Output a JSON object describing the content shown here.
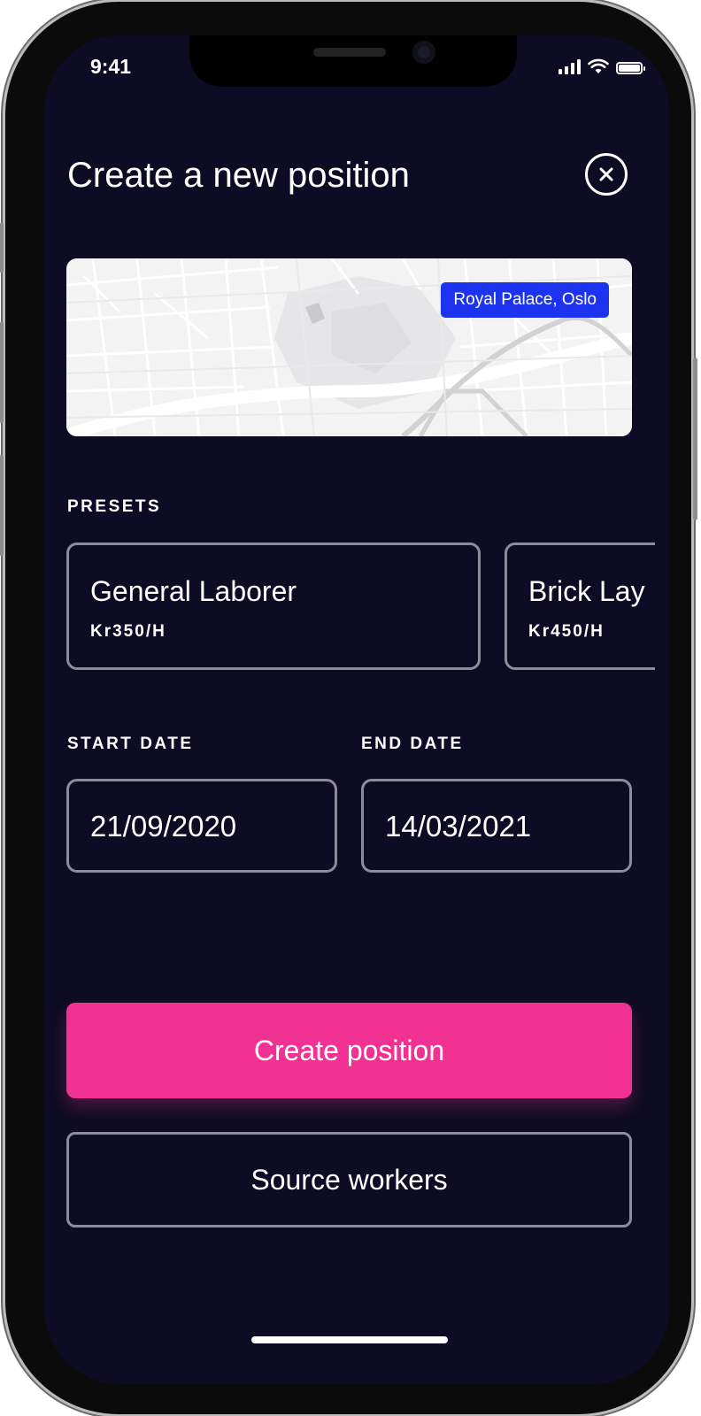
{
  "status_bar": {
    "time": "9:41"
  },
  "header": {
    "title": "Create a new position",
    "close_icon": "close-circle-icon"
  },
  "map": {
    "location_label": "Royal Palace, Oslo"
  },
  "presets": {
    "label": "PRESETS",
    "items": [
      {
        "name": "General Laborer",
        "rate": "Kr350/H"
      },
      {
        "name": "Brick Lay",
        "rate": "Kr450/H"
      }
    ]
  },
  "dates": {
    "start_label": "START DATE",
    "start_value": "21/09/2020",
    "end_label": "END DATE",
    "end_value": "14/03/2021"
  },
  "actions": {
    "primary_label": "Create position",
    "secondary_label": "Source workers"
  },
  "colors": {
    "background": "#0e0c24",
    "accent": "#f23293",
    "map_badge": "#1c33f0",
    "border": "#8e8c9c"
  }
}
